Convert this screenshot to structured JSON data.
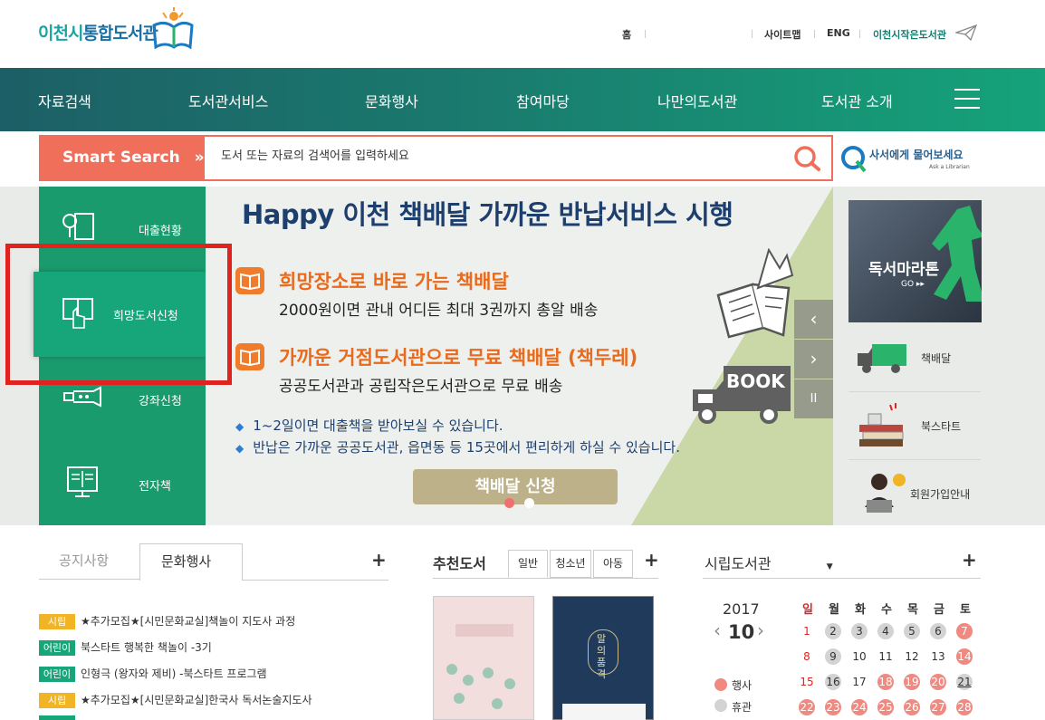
{
  "header": {
    "logo_part1": "이천시",
    "logo_part2": "통합도서관",
    "util_links": [
      "홈",
      "사이트맵",
      "ENG",
      "이천시작은도서관"
    ]
  },
  "nav": {
    "items": [
      "자료검색",
      "도서관서비스",
      "문화행사",
      "참여마당",
      "나만의도서관",
      "도서관 소개"
    ]
  },
  "search": {
    "smart_label": "Smart Search",
    "smart_arrow": "»",
    "placeholder": "도서 또는 자료의 검색어를 입력하세요",
    "ask_main": "사서에게 물어보세요",
    "ask_sub": "Ask a Librarian"
  },
  "side_menu": {
    "items": [
      "대출현황",
      "희망도서신청",
      "강좌신청",
      "전자책"
    ]
  },
  "banner": {
    "title": "Happy 이천 책배달 가까운 반납서비스 시행",
    "item1_title": "희망장소로 바로 가는 책배달",
    "item1_sub": "2000원이면 관내 어디든 최대 3권까지 총알 배송",
    "item2_title": "가까운 거점도서관으로 무료 책배달 (책두레)",
    "item2_sub": "공공도서관과 공립작은도서관으로 무료 배송",
    "bullet1": "1~2일이면 대출책을 받아보실 수 있습니다.",
    "bullet2": "반납은 가까운 공공도서관, 읍면동 등 15곳에서 편리하게 하실 수 있습니다.",
    "truck_text": "BOOK",
    "apply_button": "책배달 신청",
    "controls": [
      "‹",
      "›",
      "II"
    ]
  },
  "right": {
    "marathon_title": "독서마라톤",
    "marathon_go": "GO ▸▸",
    "quick_links": [
      "책배달",
      "북스타트",
      "회원가입안내"
    ]
  },
  "board": {
    "tabs": [
      "공지사항",
      "문화행사"
    ],
    "plus": "+",
    "items": [
      {
        "tag": "시립",
        "type": "city",
        "text": "★추가모집★[시민문화교실]책놀이 지도사 과정"
      },
      {
        "tag": "어린이",
        "type": "kid",
        "text": "북스타트 행복한 책놀이 -3기"
      },
      {
        "tag": "어린이",
        "type": "kid",
        "text": "인형극 (왕자와 제비) -북스타트 프로그램"
      },
      {
        "tag": "시립",
        "type": "city",
        "text": "★추가모집★[시민문화교실]한국사 독서논술지도사"
      }
    ]
  },
  "recommend": {
    "title": "추천도서",
    "tabs": [
      "일반",
      "청소년",
      "아동"
    ],
    "plus": "+",
    "book2_title": "말의 품격"
  },
  "calendar": {
    "library": "시립도서관",
    "dropdown_icon": "▼",
    "plus": "+",
    "year": "2017",
    "month": "10",
    "prev": "‹",
    "next": "›",
    "weekdays": [
      "일",
      "월",
      "화",
      "수",
      "목",
      "금",
      "토"
    ],
    "legend_event": "행사",
    "legend_closed": "휴관",
    "colors": {
      "event": "#f08a80",
      "closed": "#d3d3d3",
      "accent": "#17a679"
    }
  }
}
